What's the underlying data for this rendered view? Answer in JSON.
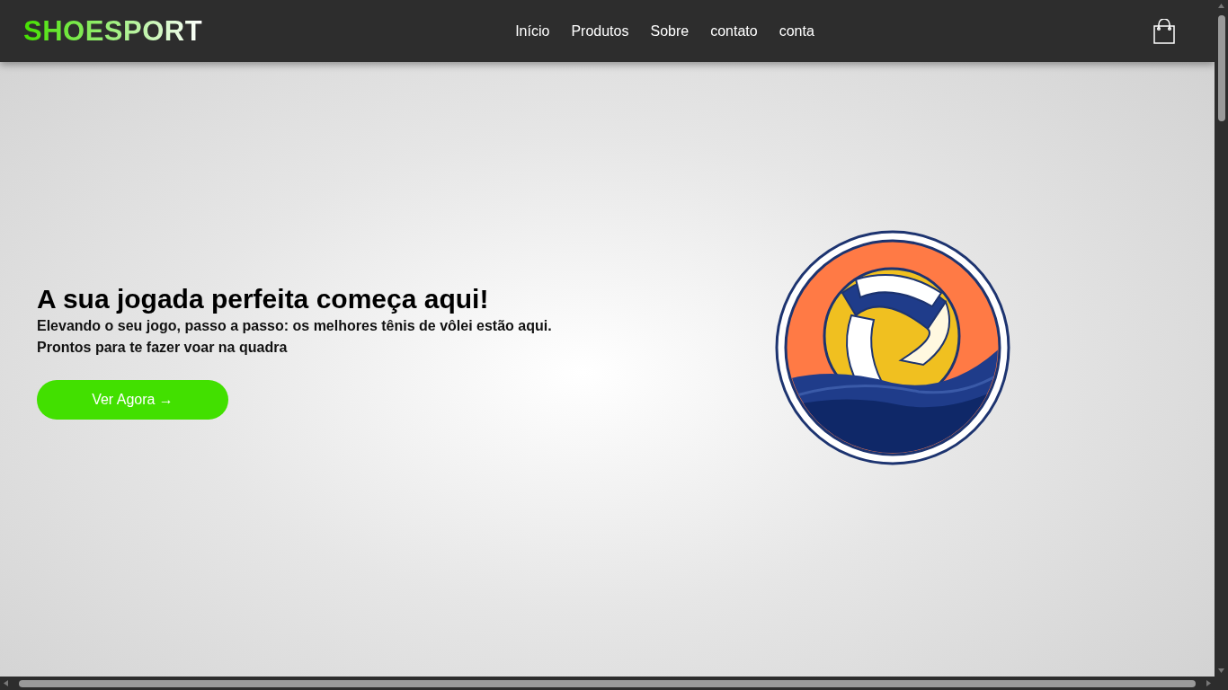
{
  "header": {
    "logo": "SHOESPORT",
    "nav": [
      {
        "label": "Início"
      },
      {
        "label": "Produtos"
      },
      {
        "label": "Sobre"
      },
      {
        "label": "contato"
      },
      {
        "label": "conta"
      }
    ]
  },
  "hero": {
    "title": "A sua jogada perfeita começa aqui!",
    "lines": [
      "Elevando o seu jogo, passo a passo: os melhores tênis de vôlei estão aqui.",
      "Prontos para te fazer voar na quadra"
    ],
    "button": "Ver Agora →"
  }
}
